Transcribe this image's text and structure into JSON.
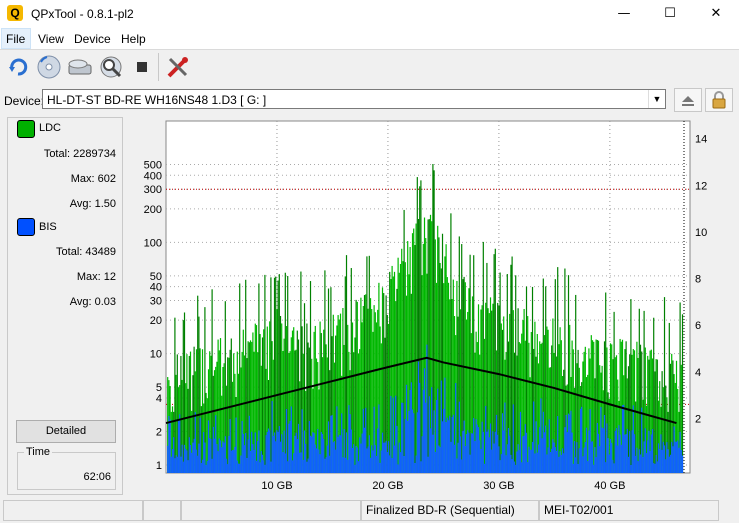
{
  "window": {
    "title": "QPxTool - 0.8.1-pl2",
    "app_icon_letter": "Q"
  },
  "menu": {
    "file": "File",
    "view": "View",
    "device": "Device",
    "help": "Help"
  },
  "device": {
    "label": "Device:",
    "value": "HL-DT-ST BD-RE  WH16NS48  1.D3 [ G: ]"
  },
  "ldc": {
    "label": "LDC",
    "color": "#00b000",
    "total_label": "Total:",
    "total": "2289734",
    "max_label": "Max:",
    "max": "602",
    "avg_label": "Avg:",
    "avg": "1.50"
  },
  "bis": {
    "label": "BIS",
    "color": "#0050ff",
    "total_label": "Total:",
    "total": "43489",
    "max_label": "Max:",
    "max": "12",
    "avg_label": "Avg:",
    "avg": "0.03"
  },
  "detailed_button": "Detailed",
  "time": {
    "label": "Time",
    "value": "62:06"
  },
  "status": {
    "cell3": "Finalized BD-R (Sequential)",
    "cell4": "MEI-T02/001"
  },
  "chart_data": {
    "type": "bar",
    "x_unit": "GB",
    "xlim": [
      0,
      46.5
    ],
    "x_ticks": [
      "10 GB",
      "20 GB",
      "30 GB",
      "40 GB"
    ],
    "x_tick_values": [
      10,
      20,
      30,
      40
    ],
    "y_left_scale": "log",
    "ylim_left": [
      1,
      1000
    ],
    "y_left_ticks": [
      "1",
      "2",
      "4",
      "5",
      "10",
      "20",
      "30",
      "40",
      "50",
      "100",
      "200",
      "300",
      "400",
      "500"
    ],
    "y_left_tick_values": [
      1,
      2,
      4,
      5,
      10,
      20,
      30,
      40,
      50,
      100,
      200,
      300,
      400,
      500
    ],
    "ylim_right": [
      0,
      14.5
    ],
    "y_right_ticks": [
      "2",
      "4",
      "6",
      "8",
      "10",
      "12",
      "14"
    ],
    "y_right_tick_values": [
      2,
      4,
      6,
      8,
      10,
      12,
      14
    ],
    "grid": true,
    "reference_lines_left": [
      300,
      3.5
    ],
    "series": [
      {
        "name": "LDC",
        "color": "#00b000",
        "x": [
          0.5,
          2,
          4,
          6,
          8,
          10,
          12,
          14,
          16,
          18,
          20,
          21,
          22,
          23,
          23.5,
          24,
          25,
          26,
          28,
          30,
          32,
          34,
          36,
          38,
          40,
          42,
          44,
          46
        ],
        "values": [
          28,
          35,
          40,
          45,
          60,
          80,
          55,
          60,
          80,
          110,
          160,
          250,
          400,
          550,
          600,
          580,
          400,
          180,
          120,
          90,
          80,
          70,
          60,
          50,
          45,
          40,
          35,
          30
        ]
      },
      {
        "name": "BIS",
        "color": "#0050ff",
        "x": [
          0.5,
          5,
          10,
          15,
          20,
          22,
          23.5,
          25,
          30,
          35,
          40,
          46
        ],
        "values": [
          2,
          2,
          3,
          3,
          3,
          5,
          12,
          6,
          3,
          3,
          3,
          2
        ]
      },
      {
        "name": "Speed",
        "color": "#000000",
        "x": [
          0,
          5,
          10,
          15,
          20,
          23.5,
          25,
          30,
          35,
          40,
          46
        ],
        "values": [
          1.8,
          2.4,
          3.0,
          3.6,
          4.2,
          4.6,
          4.4,
          3.9,
          3.3,
          2.6,
          1.8
        ]
      }
    ]
  }
}
